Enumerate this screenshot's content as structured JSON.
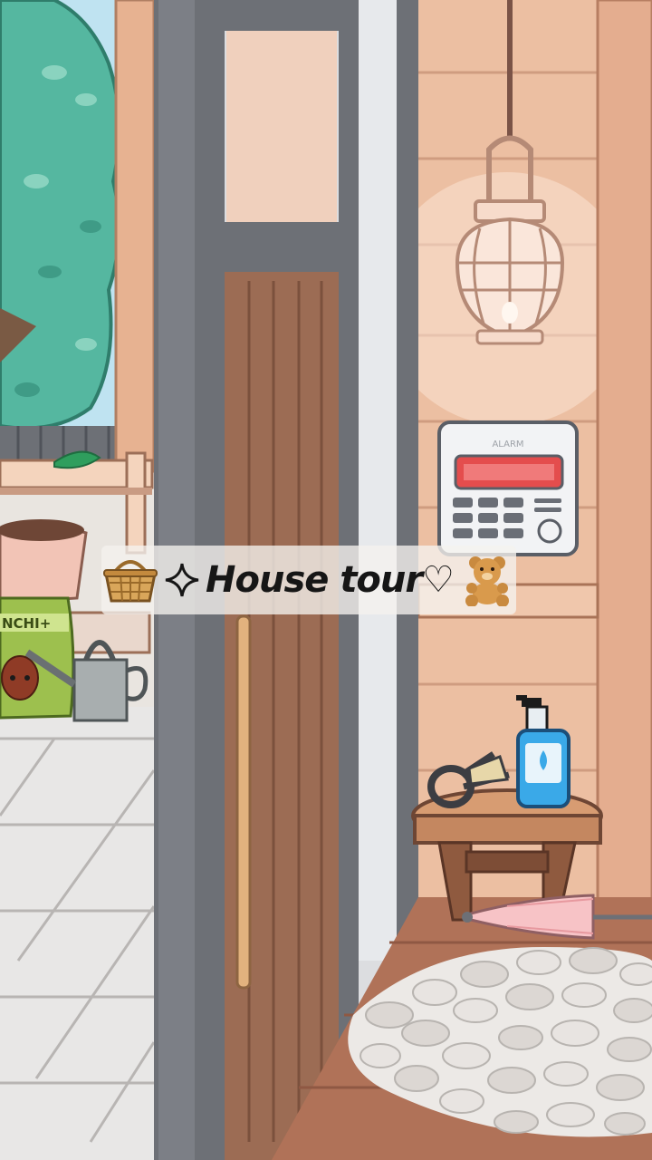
{
  "banner": {
    "left_icon": "basket-icon",
    "sparkle_icon": "sparkle-icon",
    "title": "House tour♡",
    "right_icon": "teddy-bear-icon"
  },
  "scene": {
    "alarm_panel_label": "ALARM",
    "fertilizer_bag_label": "NCHI+",
    "objects": [
      "tree",
      "fence",
      "shelf",
      "flower-pot",
      "fertilizer-bag",
      "watering-can",
      "sliding-door",
      "pendant-lamp",
      "alarm-panel",
      "stool",
      "scissors",
      "hand-sanitizer",
      "umbrella",
      "pebble-rug"
    ]
  },
  "colors": {
    "wood_wall": "#e8b99b",
    "door_wood": "#9a6a52",
    "frame": "#6d7076",
    "tree": "#4fb49a",
    "floor_tile": "#e9e7e6",
    "sanitizer": "#2fa4e0",
    "umbrella": "#f6c2c6"
  }
}
